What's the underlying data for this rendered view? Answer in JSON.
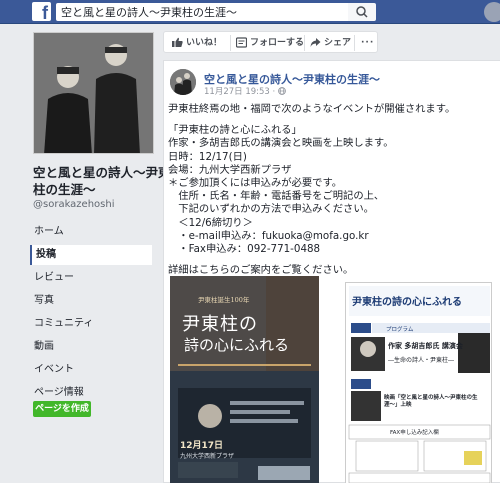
{
  "header": {
    "search_value": "空と風と星の詩人〜尹東柱の生涯〜"
  },
  "sidebar": {
    "page_name": "空と風と星の詩人〜尹東柱の生涯〜",
    "handle": "@sorakazehoshi",
    "items": [
      {
        "label": "ホーム"
      },
      {
        "label": "投稿"
      },
      {
        "label": "レビュー"
      },
      {
        "label": "写真"
      },
      {
        "label": "コミュニティ"
      },
      {
        "label": "動画"
      },
      {
        "label": "イベント"
      },
      {
        "label": "ページ情報"
      }
    ],
    "create_page_label": "ページを作成"
  },
  "actions": {
    "like": "いいね！",
    "follow": "フォローする",
    "share": "シェア",
    "more": "···"
  },
  "post": {
    "author": "空と風と星の詩人〜尹東柱の生涯〜",
    "timestamp": "11月27日 19:53 · ",
    "lines": [
      "尹東柱終焉の地・福岡で次のようなイベントが開催されます。",
      "",
      "「尹東柱の詩と心にふれる」",
      "作家・多胡吉郎氏の講演会と映画を上映します。",
      "日時：12/17(日)",
      "会場：九州大学西新プラザ",
      "＊ご参加頂くには申込みが必要です。",
      "　住所・氏名・年齢・電話番号をご明記の上、",
      "　下記のいずれかの方法で申込みください。",
      "　＜12/6締切り＞",
      "　・e-mail申込み：fukuoka@mofa.go.kr",
      "　・Fax申込み：092-771-0488",
      "",
      "詳細はこちらのご案内をご覧ください。"
    ],
    "flyer_left": {
      "tag": "尹東柱誕生100年",
      "title_line1": "尹東柱の",
      "title_line2": "詩の心にふれる",
      "date": "12月17日",
      "venue": "九州大学西新プラザ"
    },
    "flyer_right": {
      "title": "尹東柱の詩の心にふれる",
      "program": "プログラム",
      "speaker": "作家 多胡吉郎氏 講演会",
      "lecture": "―生命の詩人・尹東柱―",
      "film": "映画「空と風と星の詩人〜尹東柱の生涯〜」上映",
      "form": "FAX申し込み記入欄"
    }
  }
}
